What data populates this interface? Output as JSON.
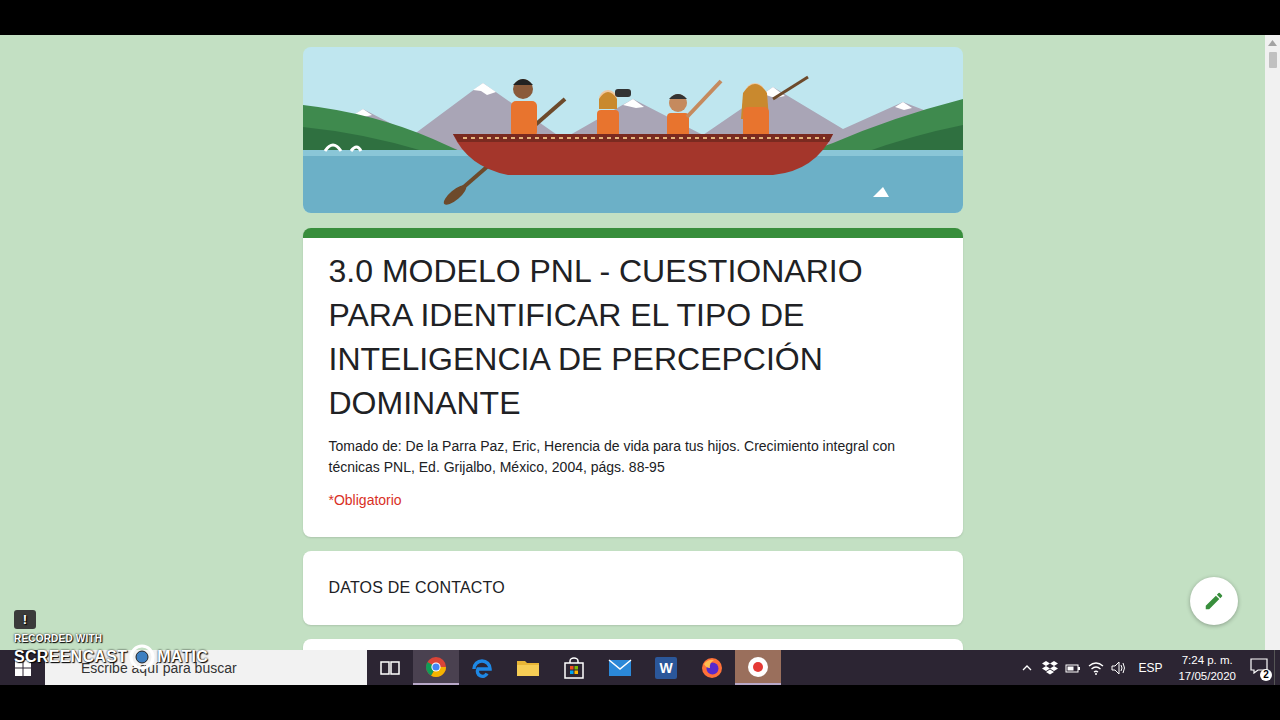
{
  "form": {
    "title": "3.0 MODELO PNL - CUESTIONARIO PARA IDENTIFICAR EL TIPO DE INTELIGENCIA DE PERCEPCIÓN DOMINANTE",
    "description": "Tomado de: De la Parra Paz, Eric, Herencia de vida para tus hijos. Crecimiento integral con técnicas PNL, Ed. Grijalbo, México, 2004, págs. 88-95",
    "required_note": "*Obligatorio",
    "sections": [
      {
        "title": "DATOS DE CONTACTO"
      }
    ]
  },
  "watermark": {
    "alert_icon": "!",
    "line1": "RECORDED WITH",
    "line2": "SCREENCAST",
    "line3": "MATIC"
  },
  "taskbar": {
    "search_placeholder": "Escribe aquí para buscar",
    "apps": [
      {
        "kind": "taskview",
        "active": false
      },
      {
        "kind": "chrome",
        "active": true
      },
      {
        "kind": "edge",
        "active": false
      },
      {
        "kind": "files",
        "active": false
      },
      {
        "kind": "store",
        "active": false
      },
      {
        "kind": "mail",
        "active": false
      },
      {
        "kind": "word",
        "active": false,
        "glyph": "W"
      },
      {
        "kind": "firefox",
        "active": false
      },
      {
        "kind": "recorder",
        "active": true
      }
    ],
    "tray": [
      {
        "kind": "chevron"
      },
      {
        "kind": "dropbox"
      },
      {
        "kind": "battery"
      },
      {
        "kind": "wifi"
      },
      {
        "kind": "volume"
      }
    ],
    "language": "ESP",
    "time": "7:24 p. m.",
    "date": "17/05/2020",
    "notifications": "2"
  }
}
